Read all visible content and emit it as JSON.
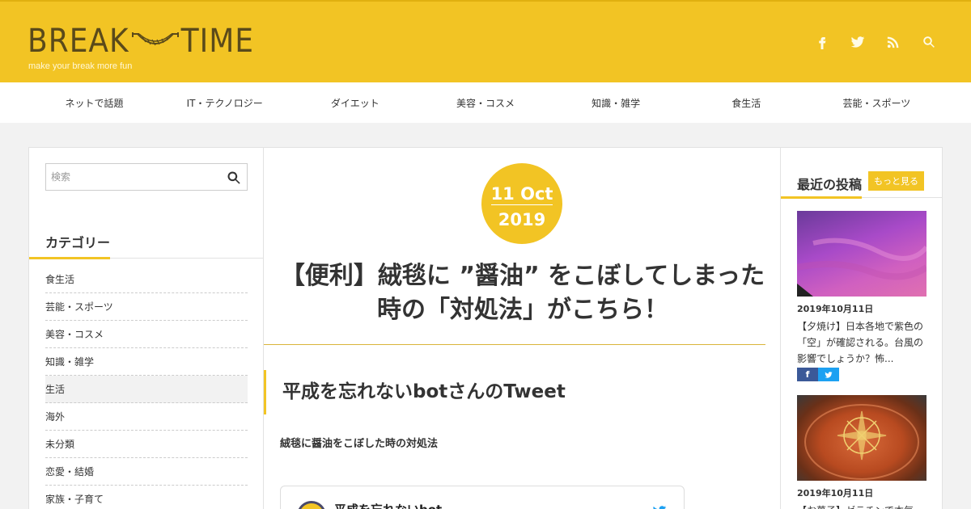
{
  "header": {
    "logo_left": "BREAK",
    "logo_right": "TIME",
    "tagline": "make your break more fun",
    "icons": [
      "facebook-icon",
      "twitter-icon",
      "rss-icon",
      "search-icon"
    ],
    "color": "#f2c424"
  },
  "nav": {
    "items": [
      "ネットで話題",
      "IT・テクノロジー",
      "ダイエット",
      "美容・コスメ",
      "知識・雑学",
      "食生活",
      "芸能・スポーツ"
    ]
  },
  "left_sidebar": {
    "search_placeholder": "検索",
    "category_title": "カテゴリー",
    "categories": [
      "食生活",
      "芸能・スポーツ",
      "美容・コスメ",
      "知識・雑学",
      "生活",
      "海外",
      "未分類",
      "恋愛・結婚",
      "家族・子育て"
    ],
    "active_category": "生活"
  },
  "article": {
    "date_line1": "11 Oct",
    "date_line2": "2019",
    "title_line1": "【便利】絨毯に ”醤油” をこぼしてしまった",
    "title_line2": "時の「対処法」がこちら！",
    "subheading": "平成を忘れないbotさんのTweet",
    "lead": "絨毯に醤油をこぼした時の対処法",
    "tweet_author": "平成を忘れないbot"
  },
  "right_sidebar": {
    "recent_title": "最近の投稿",
    "more_label": "もっと見る",
    "posts": [
      {
        "date": "2019年10月11日",
        "text": "【夕焼け】日本各地で紫色の「空」が確認される。台風の影響でしょうか？怖..."
      },
      {
        "date": "2019年10月11日",
        "text": "【お菓子】ゼラチンで本気"
      }
    ],
    "share_facebook": "f",
    "share_twitter": "t"
  }
}
